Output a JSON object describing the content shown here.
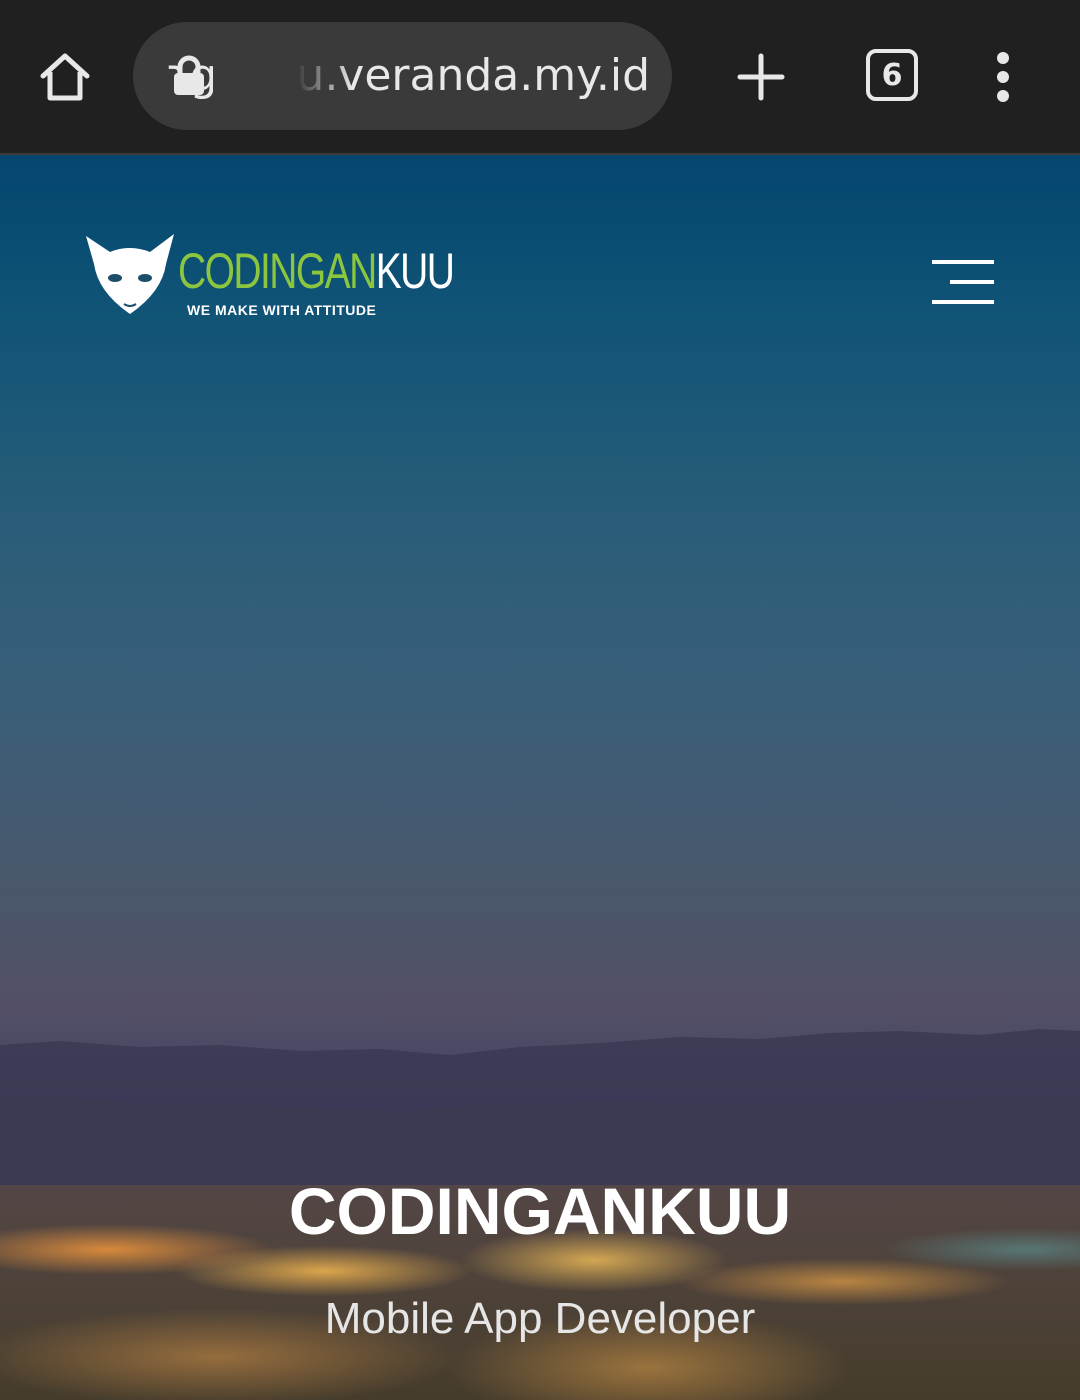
{
  "browser": {
    "url": "ɿganku.veranda.my.id",
    "tab_count": "6",
    "icons": {
      "home": "home-icon",
      "lock": "lock-icon",
      "new_tab": "plus-icon",
      "tabs": "tab-switcher-icon",
      "menu": "more-vertical-icon"
    }
  },
  "site": {
    "logo": {
      "word_green": "CODINGAN",
      "word_white": "KUU",
      "tagline": "WE MAKE WITH ATTITUDE",
      "accent_color": "#8cc63f"
    },
    "nav": {
      "icon": "hamburger-menu-icon"
    },
    "hero": {
      "title": "CODINGANKUU",
      "subtitle": "Mobile App Developer"
    }
  }
}
